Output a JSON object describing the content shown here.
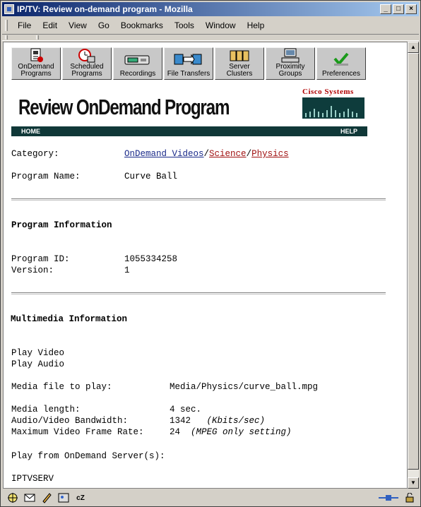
{
  "window": {
    "title": "IP/TV: Review on-demand program - Mozilla"
  },
  "menu": [
    "File",
    "Edit",
    "View",
    "Go",
    "Bookmarks",
    "Tools",
    "Window",
    "Help"
  ],
  "nav": [
    {
      "line1": "OnDemand",
      "line2": "Programs",
      "icon": "ondemand-programs-icon"
    },
    {
      "line1": "Scheduled",
      "line2": "Programs",
      "icon": "scheduled-programs-icon"
    },
    {
      "line1": "Recordings",
      "line2": "",
      "icon": "recordings-icon"
    },
    {
      "line1": "File Transfers",
      "line2": "",
      "icon": "file-transfers-icon"
    },
    {
      "line1": "Server",
      "line2": "Clusters",
      "icon": "server-clusters-icon"
    },
    {
      "line1": "Proximity",
      "line2": "Groups",
      "icon": "proximity-groups-icon"
    },
    {
      "line1": "Preferences",
      "line2": "",
      "icon": "preferences-icon"
    }
  ],
  "header": {
    "title": "Review OnDemand Program",
    "brand": "Cisco Systems",
    "home": "HOME",
    "help": "HELP"
  },
  "category": {
    "label": "Category:",
    "path": [
      "OnDemand Videos",
      "Science",
      "Physics"
    ],
    "sep": "/"
  },
  "program_name": {
    "label": "Program Name:",
    "value": "Curve Ball"
  },
  "program_info": {
    "heading": "Program Information",
    "id_label": "Program ID:",
    "id_value": "1055334258",
    "version_label": "Version:",
    "version_value": "1"
  },
  "multimedia": {
    "heading": "Multimedia Information",
    "play_video": "Play Video",
    "play_audio": "Play Audio",
    "media_file_label": "Media file to play:",
    "media_file_value": "Media/Physics/curve_ball.mpg",
    "media_length_label": "Media length:",
    "media_length_value": "4 sec.",
    "bandwidth_label": "Audio/Video Bandwidth:",
    "bandwidth_value": "1342",
    "bandwidth_unit": "(Kbits/sec)",
    "framerate_label": "Maximum Video Frame Rate:",
    "framerate_value": "24",
    "framerate_note": "(MPEG only setting)",
    "server_label": "Play from OnDemand Server(s):",
    "server_value": "IPTVSERV"
  },
  "colors": {
    "titlebar": "#0a246a",
    "headerbar": "#103838",
    "link_blue": "#1a2a8a",
    "link_red": "#a01010",
    "cisco_red": "#b00000"
  }
}
